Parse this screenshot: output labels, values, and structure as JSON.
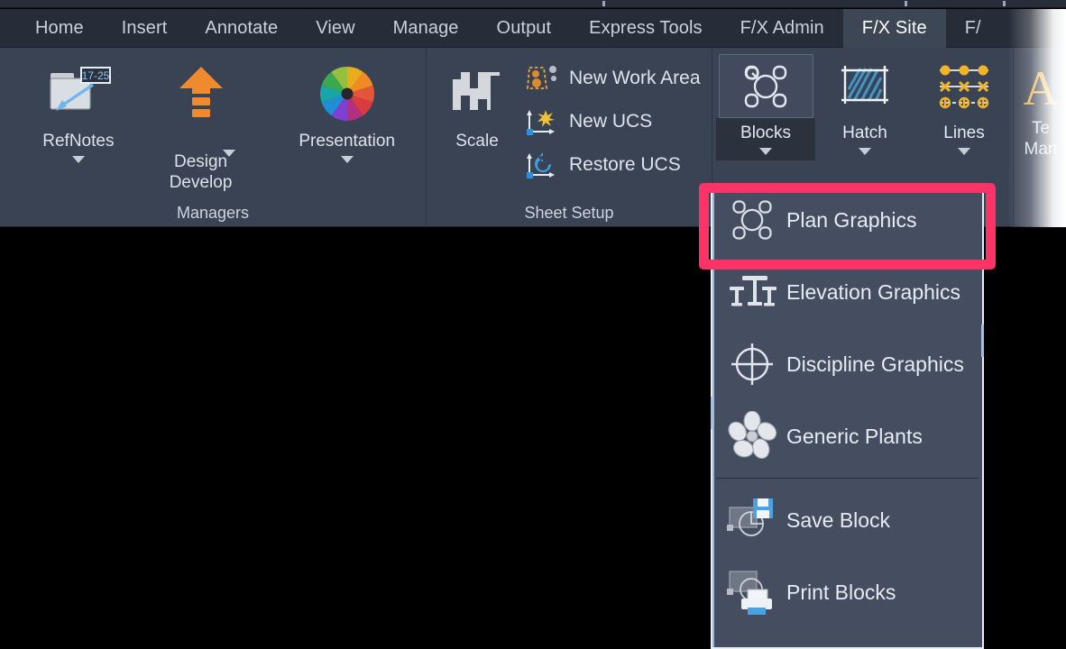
{
  "window": {
    "background_color": "#000000",
    "ribbon_bg": "#3a4354",
    "tabstrip_bg": "#272d38",
    "accent_highlight": "#fb3366",
    "text_color": "#dbe2ea"
  },
  "tabstrip": {
    "tabs": [
      {
        "label": "Home",
        "active": false
      },
      {
        "label": "Insert",
        "active": false
      },
      {
        "label": "Annotate",
        "active": false
      },
      {
        "label": "View",
        "active": false
      },
      {
        "label": "Manage",
        "active": false
      },
      {
        "label": "Output",
        "active": false
      },
      {
        "label": "Express Tools",
        "active": false
      },
      {
        "label": "F/X Admin",
        "active": false
      },
      {
        "label": "F/X Site",
        "active": true
      },
      {
        "label": "F/",
        "active": false,
        "clipped": true
      }
    ]
  },
  "ribbon": {
    "panels": [
      {
        "title": "Managers",
        "buttons": [
          {
            "label": "RefNotes",
            "icon": "refnotes-folder-icon",
            "badge": "17-25",
            "has_caret": true
          },
          {
            "label": "Design\nDevelop",
            "icon": "design-develop-arrow-icon",
            "has_caret": true
          },
          {
            "label": "Presentation",
            "icon": "presentation-colorwheel-icon",
            "has_caret": true
          }
        ]
      },
      {
        "title": "Sheet Setup",
        "big_button": {
          "label": "Scale",
          "icon": "scale-bars-icon"
        },
        "rows": [
          {
            "label": "New Work Area",
            "icon": "new-work-area-icon"
          },
          {
            "label": "New UCS",
            "icon": "new-ucs-icon"
          },
          {
            "label": "Restore UCS",
            "icon": "restore-ucs-icon"
          }
        ]
      },
      {
        "title": "",
        "buttons": [
          {
            "label": "Blocks",
            "icon": "blocks-icon",
            "has_caret": true,
            "active": true
          },
          {
            "label": "Hatch",
            "icon": "hatch-icon",
            "has_caret": true,
            "active": false
          },
          {
            "label": "Lines",
            "icon": "lines-icon",
            "has_caret": true,
            "active": false
          }
        ]
      },
      {
        "title": "",
        "clipped_button": {
          "label": "Te\nMan",
          "icon": "text-manager-A-icon"
        }
      }
    ]
  },
  "flyout": {
    "open_from": "Blocks",
    "groups": [
      {
        "items": [
          {
            "label": "Plan Graphics",
            "icon": "plan-graphics-icon",
            "highlighted": true
          },
          {
            "label": "Elevation Graphics",
            "icon": "elevation-graphics-icon",
            "highlighted": false
          },
          {
            "label": "Discipline Graphics",
            "icon": "discipline-graphics-icon",
            "highlighted": false
          },
          {
            "label": "Generic Plants",
            "icon": "generic-plants-icon",
            "highlighted": false
          }
        ]
      },
      {
        "items": [
          {
            "label": "Save Block",
            "icon": "save-block-icon",
            "highlighted": false
          },
          {
            "label": "Print Blocks",
            "icon": "print-blocks-icon",
            "highlighted": false
          }
        ]
      }
    ]
  }
}
